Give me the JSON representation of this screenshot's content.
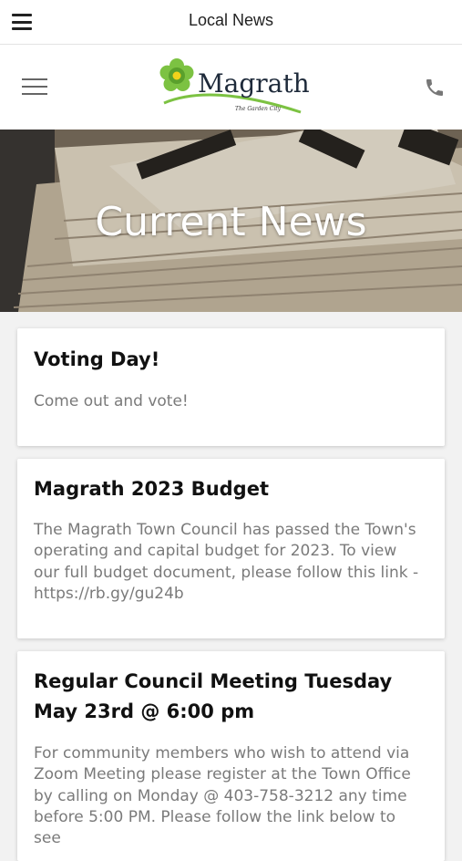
{
  "topbar": {
    "title": "Local News"
  },
  "header": {
    "logo": {
      "name": "Magrath",
      "tagline": "The Garden City"
    }
  },
  "hero": {
    "title": "Current News"
  },
  "news": [
    {
      "title": "Voting Day!",
      "body": "Come out and vote!"
    },
    {
      "title": "Magrath 2023 Budget",
      "body": "The Magrath Town Council has passed the Town's operating and capital budget for 2023. To view our full budget document, please follow this link - https://rb.gy/gu24b"
    },
    {
      "title": "Regular Council Meeting Tuesday May 23rd @ 6:00 pm",
      "body": "For community members who wish to attend via Zoom Meeting please register at the Town Office by calling on Monday @ 403-758-3212 any time before 5:00 PM. Please follow the link below to see"
    }
  ]
}
